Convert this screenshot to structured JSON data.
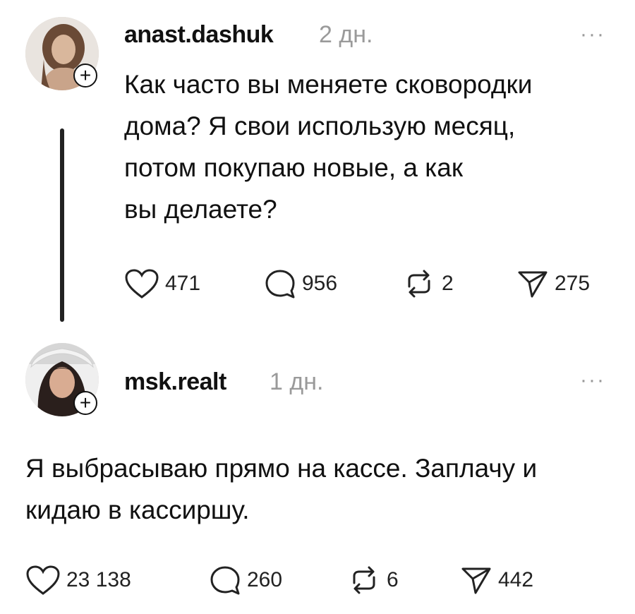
{
  "posts": [
    {
      "username": "anast.dashuk",
      "time": "2 дн.",
      "more_label": "···",
      "add_label": "+",
      "text_lines": [
        "Как часто вы меняете сковородки",
        "дома? Я свои использую месяц,",
        "потом покупаю новые, а как",
        "вы делаете?"
      ],
      "likes": "471",
      "comments": "956",
      "reposts": "2",
      "shares": "275"
    },
    {
      "username": "msk.realt",
      "time": "1 дн.",
      "more_label": "···",
      "add_label": "+",
      "text_lines": [
        "Я выбрасываю прямо на кассе. Заплачу и",
        "кидаю в кассиршу."
      ],
      "likes": "23 138",
      "comments": "260",
      "reposts": "6",
      "shares": "442"
    }
  ],
  "icons": {
    "like": "heart-icon",
    "comment": "comment-bubble-icon",
    "repost": "repost-icon",
    "share": "share-send-icon",
    "add": "plus-icon",
    "more": "more-dots-icon"
  },
  "colors": {
    "text": "#111111",
    "muted": "#9a9a9a",
    "background": "#ffffff"
  }
}
